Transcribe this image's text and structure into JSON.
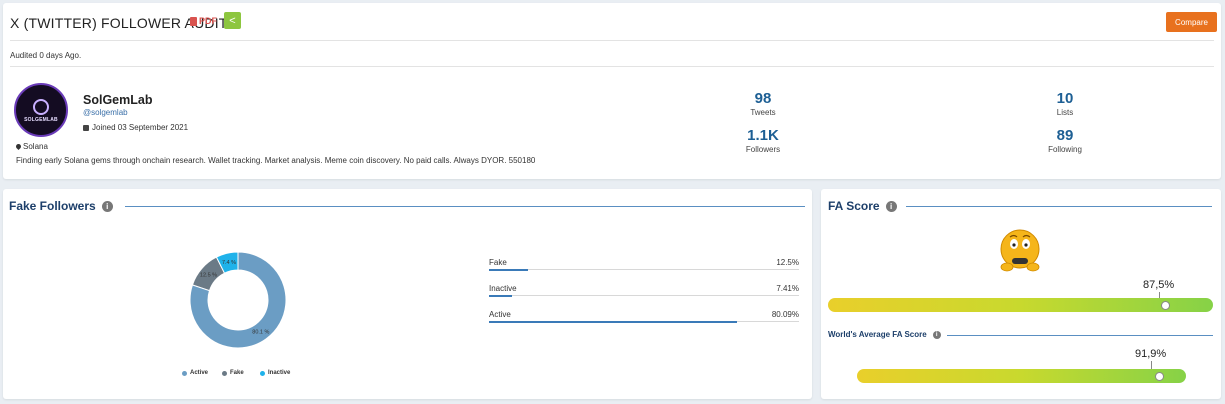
{
  "header": {
    "title": "X (TWITTER) FOLLOWER AUDIT",
    "pdf_label": "PDF",
    "compare_label": "Compare",
    "audited": "Audited 0 days Ago."
  },
  "profile": {
    "avatar_text": "SOLGEMLAB",
    "name": "SolGemLab",
    "handle": "@solgemlab",
    "joined": "Joined 03 September 2021",
    "location": "Solana",
    "bio": "Finding early Solana gems through onchain research. Wallet tracking. Market analysis. Meme coin discovery. No paid calls. Always DYOR. 550180"
  },
  "stats": [
    {
      "value": "98",
      "label": "Tweets"
    },
    {
      "value": "10",
      "label": "Lists"
    },
    {
      "value": "1.1K",
      "label": "Followers"
    },
    {
      "value": "89",
      "label": "Following"
    }
  ],
  "fake_followers": {
    "title": "Fake Followers",
    "legend": [
      "Active",
      "Fake",
      "Inactive"
    ],
    "rows": [
      {
        "label": "Fake",
        "pct_text": "12.5%",
        "fraction": 0.125
      },
      {
        "label": "Inactive",
        "pct_text": "7.41%",
        "fraction": 0.0741
      },
      {
        "label": "Active",
        "pct_text": "80.09%",
        "fraction": 0.8009
      }
    ]
  },
  "chart_data": {
    "type": "pie",
    "categories": [
      "Active",
      "Fake",
      "Inactive"
    ],
    "values": [
      80.09,
      12.5,
      7.41
    ],
    "colors": [
      "#6b9dc4",
      "#6b7a86",
      "#1fb2ea"
    ],
    "slice_labels": [
      "80.1 %",
      "12.5 %",
      "7.4 %"
    ]
  },
  "fa_score": {
    "title": "FA Score",
    "score_text": "87,5%",
    "score_fraction": 0.875,
    "world_title": "World's Average FA Score",
    "world_text": "91,9%",
    "world_fraction": 0.919
  },
  "colors": {
    "accent": "#1d5f94",
    "compare": "#e8711e",
    "share": "#8dc63f",
    "pdf": "#d9534f"
  }
}
